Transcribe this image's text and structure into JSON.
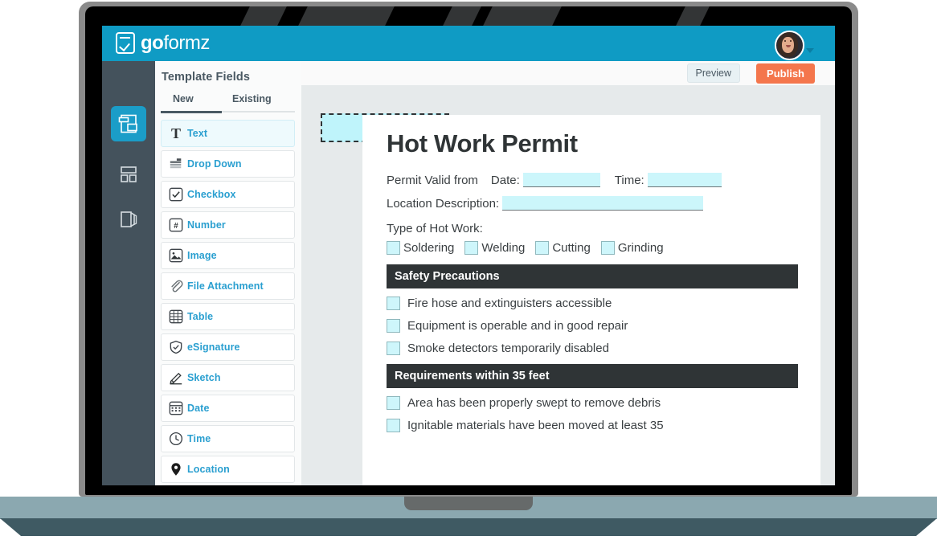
{
  "header": {
    "logo_bold": "go",
    "logo_light": "formz",
    "logo_icon": "checklist-icon",
    "avatar_alt": "user-avatar",
    "caret_icon": "chevron-down-icon",
    "accent_color": "#0f9bc4"
  },
  "rail": {
    "items": [
      {
        "icon": "fields-layers-icon",
        "active": true
      },
      {
        "icon": "layout-grid-icon",
        "active": false
      },
      {
        "icon": "pages-stack-icon",
        "active": false
      }
    ],
    "background_color": "#44525c",
    "active_color": "#1b9dc8"
  },
  "panel": {
    "title": "Template Fields",
    "tabs": [
      {
        "label": "New",
        "active": true
      },
      {
        "label": "Existing",
        "active": false
      }
    ],
    "fields": [
      {
        "label": "Text",
        "icon": "text-t-icon",
        "selected": true
      },
      {
        "label": "Drop Down",
        "icon": "dropdown-icon",
        "selected": false
      },
      {
        "label": "Checkbox",
        "icon": "checkbox-icon",
        "selected": false
      },
      {
        "label": "Number",
        "icon": "number-hash-icon",
        "selected": false
      },
      {
        "label": "Image",
        "icon": "image-icon",
        "selected": false
      },
      {
        "label": "File Attachment",
        "icon": "paperclip-icon",
        "selected": false
      },
      {
        "label": "Table",
        "icon": "table-grid-icon",
        "selected": false
      },
      {
        "label": "eSignature",
        "icon": "shield-check-icon",
        "selected": false
      },
      {
        "label": "Sketch",
        "icon": "pencil-icon",
        "selected": false
      },
      {
        "label": "Date",
        "icon": "calendar-icon",
        "selected": false
      },
      {
        "label": "Time",
        "icon": "clock-icon",
        "selected": false
      },
      {
        "label": "Location",
        "icon": "map-pin-icon",
        "selected": false
      }
    ],
    "field_label_color": "#2a9fd0"
  },
  "toolbar": {
    "preview_label": "Preview",
    "publish_label": "Publish",
    "publish_color": "#f4764c"
  },
  "drag": {
    "ghost_icon": "drag-placeholder",
    "cursor_icon": "mouse-pointer-icon",
    "fill_color": "#bff4fb"
  },
  "form": {
    "title": "Hot Work Permit",
    "valid_from_label": "Permit Valid from",
    "date_label": "Date:",
    "time_label": "Time:",
    "location_label": "Location Description:",
    "type_label": "Type of Hot Work:",
    "work_types": [
      "Soldering",
      "Welding",
      "Cutting",
      "Grinding"
    ],
    "sections": [
      {
        "heading": "Safety Precautions",
        "items": [
          "Fire hose and extinguisters accessible",
          "Equipment is operable and in good repair",
          "Smoke detectors temporarily disabled"
        ]
      },
      {
        "heading": "Requirements within 35 feet",
        "items": [
          "Area has been properly swept to remove debris",
          "Ignitable materials have been moved at least 35"
        ]
      }
    ],
    "field_highlight_color": "#ccf6fb"
  }
}
